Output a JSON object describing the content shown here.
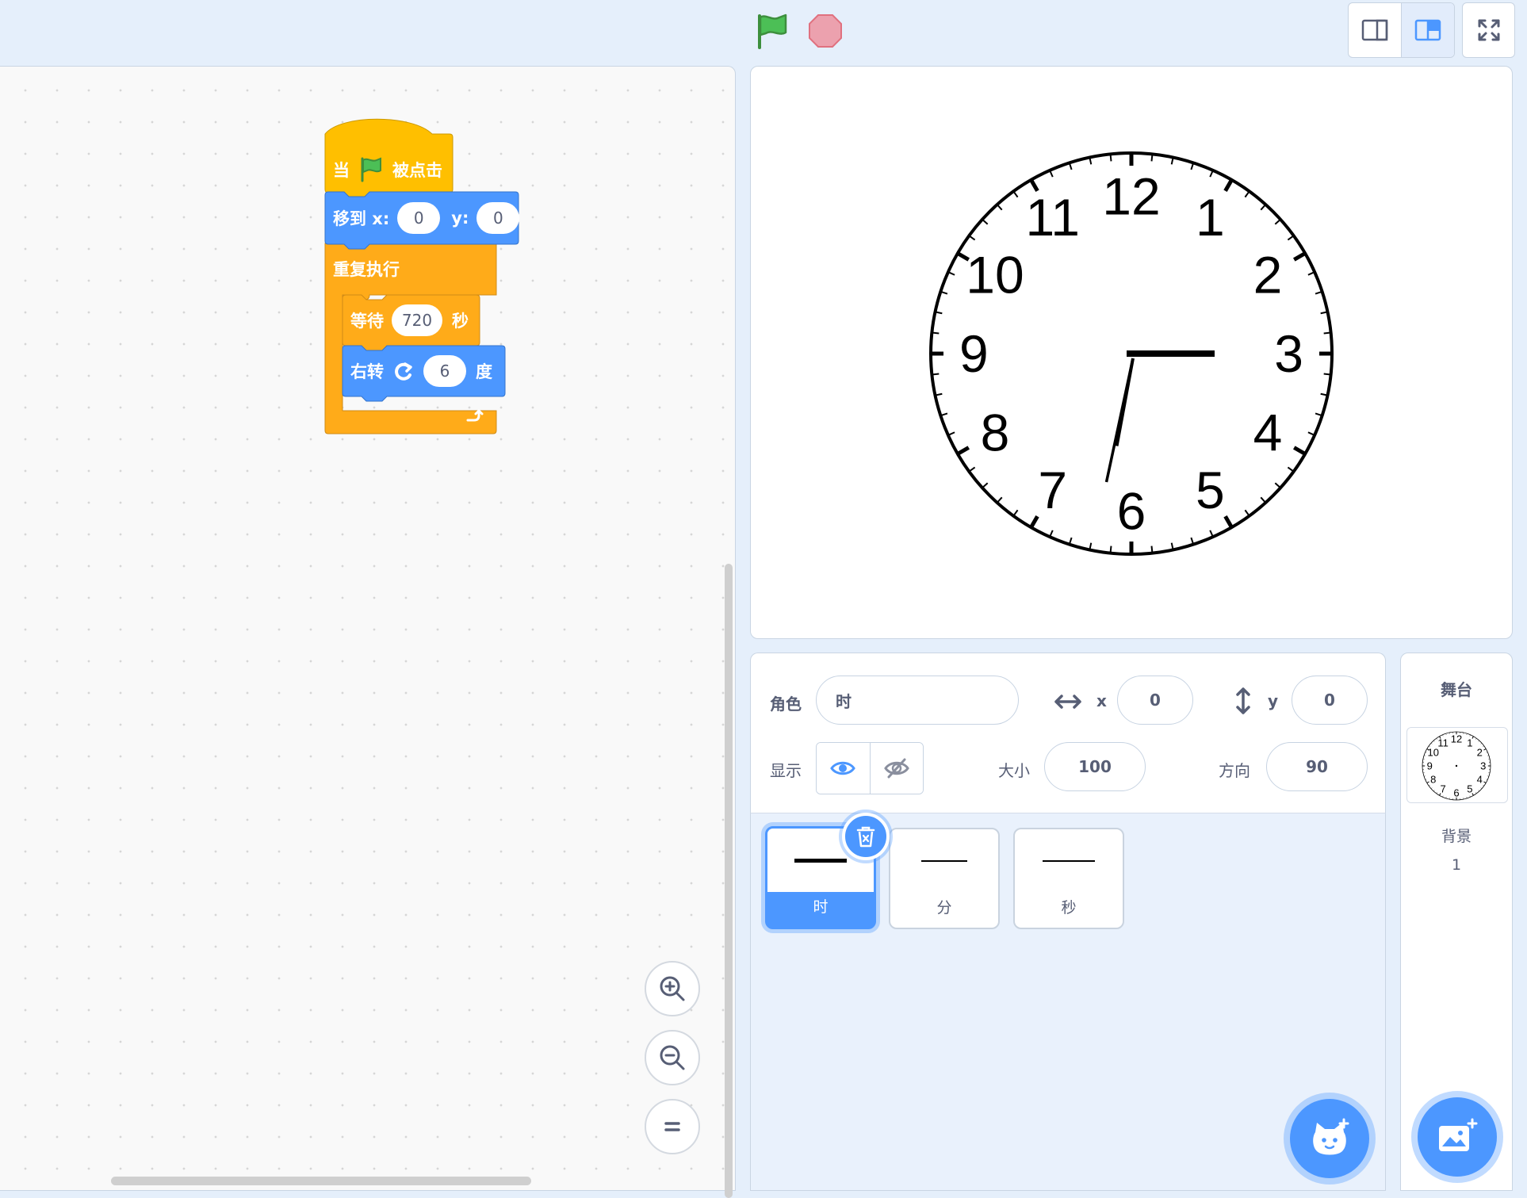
{
  "toolbar": {
    "green_flag": "green-flag-icon",
    "stop": "stop-icon",
    "layout_small": "small-stage-icon",
    "layout_normal": "normal-stage-icon",
    "fullscreen": "fullscreen-icon"
  },
  "script": {
    "hat": {
      "prefix": "当",
      "suffix": "被点击"
    },
    "goto": {
      "label": "移到 x:",
      "x": "0",
      "ylabel": "y:",
      "y": "0"
    },
    "forever": {
      "label": "重复执行"
    },
    "wait": {
      "label": "等待",
      "value": "720",
      "unit": "秒"
    },
    "turn": {
      "label": "右转",
      "value": "6",
      "unit": "度"
    }
  },
  "clock": {
    "numerals": [
      "12",
      "1",
      "2",
      "3",
      "4",
      "5",
      "6",
      "7",
      "8",
      "9",
      "10",
      "11"
    ],
    "hour_hand_direction_deg": 90,
    "minute_hand_direction_deg": 191
  },
  "sprite_info": {
    "sprite_label": "角色",
    "sprite_name": "时",
    "x_label": "x",
    "x": "0",
    "y_label": "y",
    "y": "0",
    "show_label": "显示",
    "size_label": "大小",
    "size": "100",
    "direction_label": "方向",
    "direction": "90"
  },
  "sprites": [
    {
      "name": "时",
      "selected": true
    },
    {
      "name": "分",
      "selected": false
    },
    {
      "name": "秒",
      "selected": false
    }
  ],
  "stage_panel": {
    "title": "舞台",
    "backdrops_label": "背景",
    "backdrops_count": "1"
  },
  "colors": {
    "motion": "#4c97ff",
    "events": "#ffbf00",
    "control": "#ffab19",
    "accent": "#4c97ff"
  }
}
